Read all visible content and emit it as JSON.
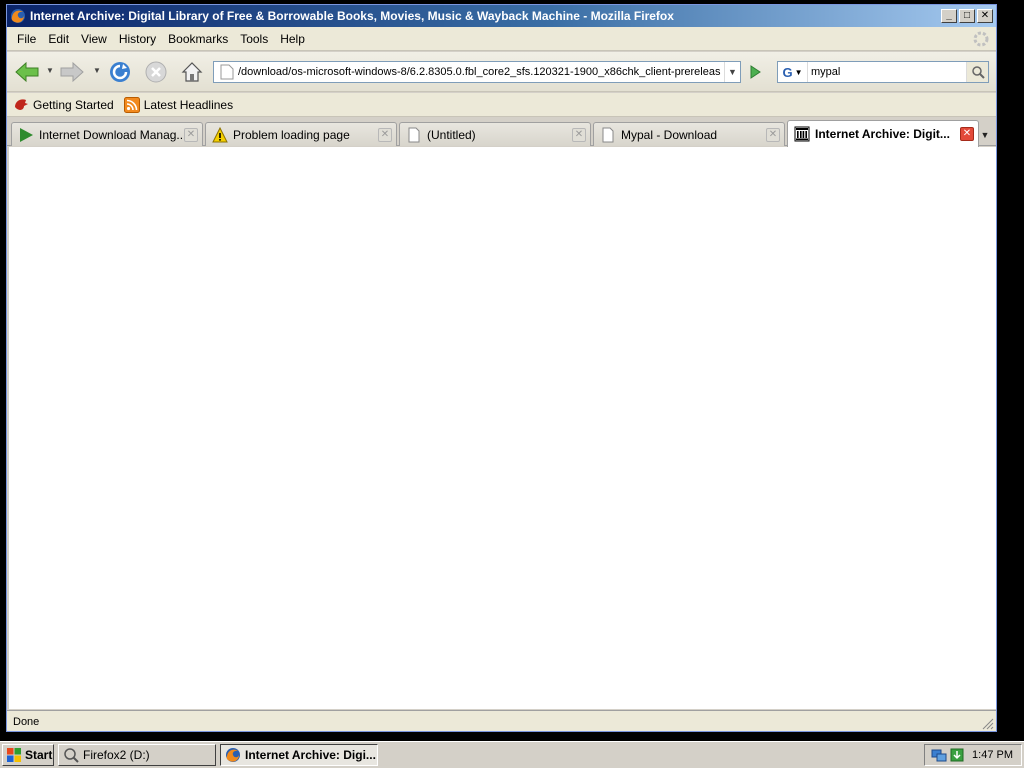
{
  "window": {
    "title": "Internet Archive: Digital Library of Free & Borrowable Books, Movies, Music & Wayback Machine - Mozilla Firefox",
    "minimize_glyph": "_",
    "maximize_glyph": "□",
    "close_glyph": "✕"
  },
  "menu": {
    "items": [
      "File",
      "Edit",
      "View",
      "History",
      "Bookmarks",
      "Tools",
      "Help"
    ]
  },
  "navbar": {
    "url": "/download/os-microsoft-windows-8/6.2.8305.0.fbl_core2_sfs.120321-1900_x86chk_client-prereleas",
    "search_value": "mypal",
    "search_engine_letter": "G"
  },
  "bookmarks": {
    "items": [
      "Getting Started",
      "Latest Headlines"
    ]
  },
  "tabs": [
    {
      "label": "Internet Download Manag...",
      "icon": "idm-play-icon",
      "active": false
    },
    {
      "label": "Problem loading page",
      "icon": "warning-icon",
      "active": false
    },
    {
      "label": "(Untitled)",
      "icon": "blank-page-icon",
      "active": false
    },
    {
      "label": "Mypal - Download",
      "icon": "blank-page-icon",
      "active": false
    },
    {
      "label": "Internet Archive: Digit...",
      "icon": "archive-icon",
      "active": true
    }
  ],
  "status": {
    "text": "Done"
  },
  "taskbar": {
    "start_label": "Start",
    "tasks": [
      {
        "label": "Firefox2 (D:)",
        "active": false
      },
      {
        "label": "Internet Archive: Digi...",
        "active": true
      }
    ],
    "clock": "1:47 PM"
  },
  "colors": {
    "titlebar_start": "#0a246a",
    "titlebar_end": "#a6caf0",
    "active_tab_close": "#e34a3a"
  }
}
